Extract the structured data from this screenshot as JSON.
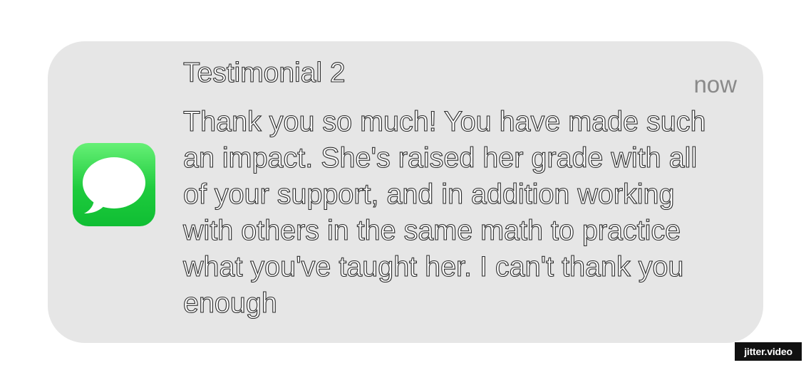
{
  "notification": {
    "app_icon": "messages-icon",
    "title": "Testimonial 2",
    "timestamp": "now",
    "message": "Thank you so much! You have made such an impact. She's raised her grade with all of your support, and in addition working with others in the same math to practice what you've taught her. I can't thank you enough"
  },
  "watermark": {
    "text": "jitter.video"
  },
  "colors": {
    "card_background": "#e6e6e6",
    "icon_green_top": "#66f076",
    "icon_green_bottom": "#0fbe33",
    "timestamp_gray": "#8a8a8a"
  }
}
